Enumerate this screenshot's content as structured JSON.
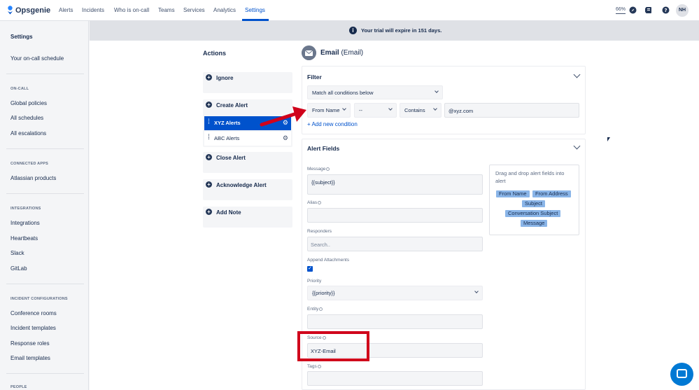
{
  "app": {
    "name": "Opsgenie"
  },
  "nav": {
    "items": [
      "Alerts",
      "Incidents",
      "Who is on-call",
      "Teams",
      "Services",
      "Analytics",
      "Settings"
    ]
  },
  "topbar": {
    "zoom": "66%",
    "avatar": "NH"
  },
  "banner": {
    "text": "Your trial will expire in 151 days."
  },
  "sidebar": {
    "heading": "Settings",
    "items": {
      "schedule": "Your on-call schedule",
      "global": "Global policies",
      "schedules": "All schedules",
      "escalations": "All escalations",
      "atlassian": "Atlassian products",
      "integrations": "Integrations",
      "heartbeats": "Heartbeats",
      "slack": "Slack",
      "gitlab": "GitLab",
      "conference": "Conference rooms",
      "templates": "Incident templates",
      "roles": "Response roles",
      "email": "Email templates"
    },
    "sections": {
      "oncall": "ON-CALL",
      "connected": "CONNECTED APPS",
      "integrations": "INTEGRATIONS",
      "incident": "INCIDENT CONFIGURATIONS",
      "people": "PEOPLE"
    }
  },
  "actions": {
    "title": "Actions",
    "ignore": "Ignore",
    "create": "Create Alert",
    "xyz": "XYZ Alerts",
    "abc": "ABC Alerts",
    "close": "Close Alert",
    "ack": "Acknowledge Alert",
    "note": "Add Note"
  },
  "email": {
    "title": "Email",
    "subtitle": "(Email)"
  },
  "filter": {
    "title": "Filter",
    "match": "Match all conditions below",
    "field": "From Name",
    "op1": "--",
    "op2": "Contains",
    "value": "@xyz.com",
    "add": "+ Add new condition"
  },
  "alert_fields": {
    "title": "Alert Fields",
    "message_label": "Message",
    "message_value": "{{subject}}",
    "alias_label": "Alias",
    "responders_label": "Responders",
    "responders_placeholder": "Search..",
    "attach_label": "Append Attachments",
    "priority_label": "Priority",
    "priority_value": "{{priority}}",
    "entity_label": "Entity",
    "source_label": "Source",
    "source_value": "XYZ-Email",
    "tags_label": "Tags"
  },
  "drag": {
    "text": "Drag and drop alert fields into alert",
    "tokens": {
      "from_name": "From Name",
      "from_address": "From Address",
      "subject": "Subject",
      "conversation": "Conversation Subject",
      "message": "Message"
    }
  },
  "colors": {
    "accent": "#0052cc",
    "annotation": "#d0021b"
  }
}
